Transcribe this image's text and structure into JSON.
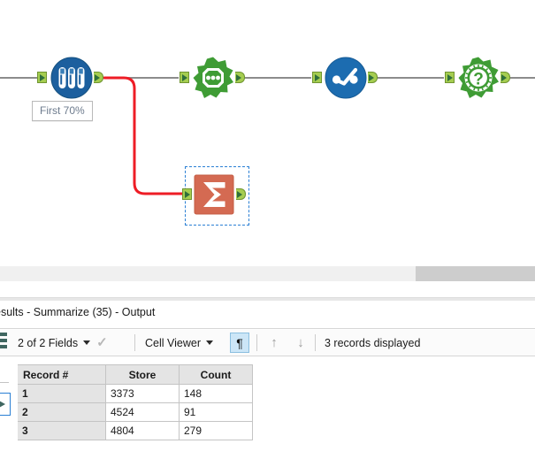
{
  "canvas": {
    "nodes": [
      {
        "id": "sample",
        "name": "sample-tool",
        "icon": "test-tubes-icon",
        "label": "First 70%",
        "selected": false
      },
      {
        "id": "gear-dots",
        "name": "formula-tool",
        "icon": "green-gear-dots-icon",
        "label": "",
        "selected": false
      },
      {
        "id": "score",
        "name": "score-tool",
        "icon": "blue-score-icon",
        "label": "",
        "selected": false
      },
      {
        "id": "question",
        "name": "question-tool",
        "icon": "green-starburst-question-icon",
        "label": "",
        "selected": false
      },
      {
        "id": "summarize",
        "name": "summarize-tool",
        "icon": "sigma-icon",
        "label": "",
        "selected": true
      }
    ],
    "connection_colors": {
      "normal": "#8c8c8c",
      "highlighted": "#ee1c25"
    }
  },
  "results": {
    "title": "esults - Summarize (35) - Output",
    "toolbar": {
      "fields_label": "2 of 2 Fields",
      "cell_viewer_label": "Cell Viewer",
      "pilcrow_label": "¶",
      "up_arrow_label": "↑",
      "down_arrow_label": "↓",
      "records_status": "3 records displayed"
    },
    "grid": {
      "columns": [
        "Record #",
        "Store",
        "Count"
      ],
      "rows": [
        [
          "1",
          "3373",
          "148"
        ],
        [
          "2",
          "4524",
          "91"
        ],
        [
          "3",
          "4804",
          "279"
        ]
      ]
    }
  }
}
